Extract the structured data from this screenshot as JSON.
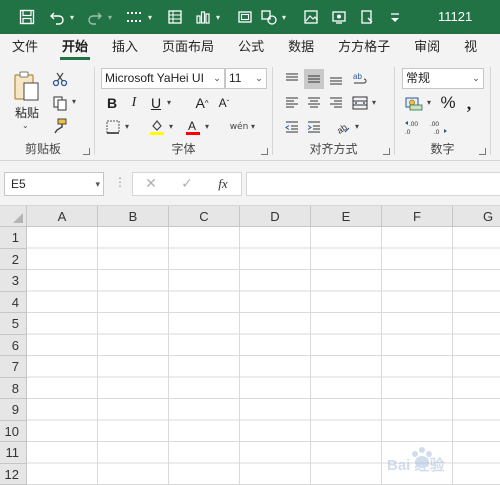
{
  "app": {
    "document_title": "11121",
    "accent_color": "#217346"
  },
  "quick_access": {
    "icons": [
      "save-icon",
      "undo-icon",
      "redo-icon",
      "more-controls-icon",
      "form-icon",
      "chart-icon",
      "camera-icon",
      "shapes-icon",
      "picture-icon",
      "screenshot-icon",
      "clipboard-icon",
      "customize-icon"
    ]
  },
  "tabs": [
    {
      "label": "文件"
    },
    {
      "label": "开始",
      "active": true
    },
    {
      "label": "插入"
    },
    {
      "label": "页面布局"
    },
    {
      "label": "公式"
    },
    {
      "label": "数据"
    },
    {
      "label": "方方格子"
    },
    {
      "label": "审阅"
    },
    {
      "label": "视"
    }
  ],
  "ribbon": {
    "clipboard": {
      "label": "剪贴板",
      "paste_label": "粘贴"
    },
    "font": {
      "label": "字体",
      "font_name": "Microsoft YaHei UI",
      "font_size": "11",
      "bold": "B",
      "italic": "I",
      "underline": "U",
      "grow": "A",
      "shrink": "A",
      "phonetic": "wén"
    },
    "alignment": {
      "label": "对齐方式"
    },
    "number": {
      "label": "数字",
      "format": "常规"
    }
  },
  "formula_bar": {
    "name_box": "E5",
    "fx_label": "fx",
    "formula": ""
  },
  "sheet": {
    "columns": [
      "A",
      "B",
      "C",
      "D",
      "E",
      "F",
      "G"
    ],
    "rows": [
      "1",
      "2",
      "3",
      "4",
      "5",
      "6",
      "7",
      "8",
      "9",
      "10",
      "11",
      "12"
    ]
  },
  "watermark": {
    "text": "Bai 经验"
  }
}
